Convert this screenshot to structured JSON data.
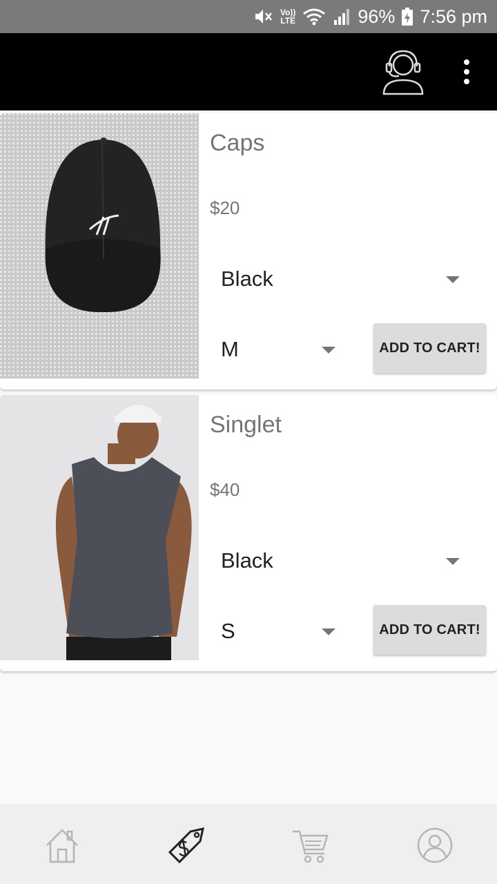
{
  "status_bar": {
    "lte_top": "Vo))",
    "lte_bottom": "LTE",
    "battery": "96%",
    "time": "7:56 pm"
  },
  "app_bar": {
    "support_icon": "customer-support-headset-icon",
    "menu_icon": "more-vert-icon"
  },
  "products": [
    {
      "name": "Caps",
      "price": "$20",
      "color": "Black",
      "size": "M",
      "add_to_cart": "ADD TO CART!",
      "image": "black-cap-photo"
    },
    {
      "name": "Singlet",
      "price": "$40",
      "color": "Black",
      "size": "S",
      "add_to_cart": "ADD TO CART!",
      "image": "man-in-grey-singlet-photo"
    }
  ],
  "bottom_nav": [
    {
      "icon": "home-icon",
      "active": false
    },
    {
      "icon": "price-tag-icon",
      "active": true
    },
    {
      "icon": "shopping-cart-icon",
      "active": false
    },
    {
      "icon": "profile-icon",
      "active": false
    }
  ],
  "colors": {
    "status_bar_bg": "#7a7a7a",
    "app_bar_bg": "#000000",
    "button_bg": "#dcdcdc",
    "text_secondary": "#757575"
  }
}
